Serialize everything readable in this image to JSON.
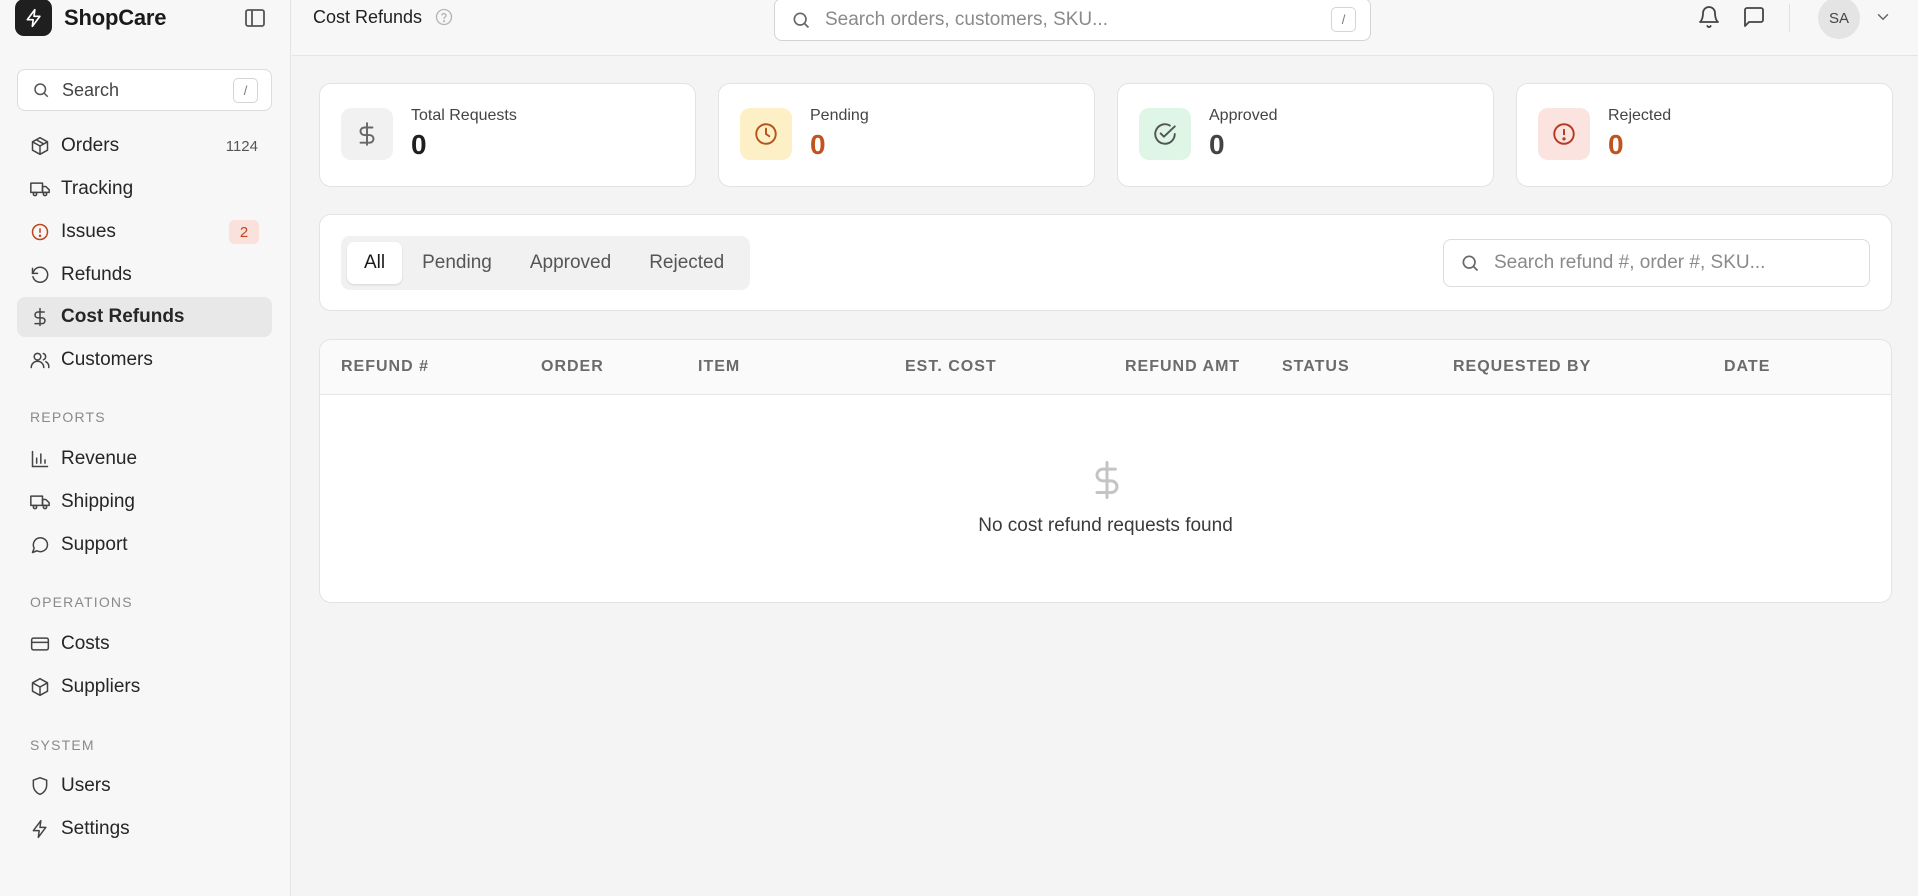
{
  "brand": {
    "name": "ShopCare"
  },
  "sidebar": {
    "search_placeholder": "Search",
    "search_shortcut": "/",
    "items": [
      {
        "label": "Orders",
        "icon": "package-icon",
        "badge": "1124"
      },
      {
        "label": "Tracking",
        "icon": "truck-icon"
      },
      {
        "label": "Issues",
        "icon": "alert-circle-icon",
        "badge": "2"
      },
      {
        "label": "Refunds",
        "icon": "rotate-ccw-icon"
      },
      {
        "label": "Cost Refunds",
        "icon": "dollar-icon",
        "active": true
      },
      {
        "label": "Customers",
        "icon": "users-icon"
      }
    ],
    "sections": [
      {
        "title": "REPORTS",
        "items": [
          {
            "label": "Revenue",
            "icon": "bar-chart-icon"
          },
          {
            "label": "Shipping",
            "icon": "truck-icon"
          },
          {
            "label": "Support",
            "icon": "message-circle-icon"
          }
        ]
      },
      {
        "title": "OPERATIONS",
        "items": [
          {
            "label": "Costs",
            "icon": "credit-card-icon"
          },
          {
            "label": "Suppliers",
            "icon": "box-icon"
          }
        ]
      },
      {
        "title": "SYSTEM",
        "items": [
          {
            "label": "Users",
            "icon": "shield-icon"
          },
          {
            "label": "Settings",
            "icon": "zap-icon"
          }
        ]
      }
    ]
  },
  "header": {
    "title": "Cost Refunds",
    "search_placeholder": "Search orders, customers, SKU...",
    "search_shortcut": "/",
    "avatar_initials": "SA"
  },
  "stats": [
    {
      "label": "Total Requests",
      "value": "0",
      "icon": "dollar-icon",
      "value_color": "#1f1f1f",
      "icon_bg": "#f1f1f1",
      "icon_color": "#666666"
    },
    {
      "label": "Pending",
      "value": "0",
      "icon": "clock-icon",
      "value_color": "#c2531f",
      "icon_bg": "#fdf0c7",
      "icon_color": "#b3551c"
    },
    {
      "label": "Approved",
      "value": "0",
      "icon": "check-circle-icon",
      "value_color": "#444444",
      "icon_bg": "#dff6e7",
      "icon_color": "#555555"
    },
    {
      "label": "Rejected",
      "value": "0",
      "icon": "alert-circle-icon",
      "value_color": "#c2531f",
      "icon_bg": "#fbe3df",
      "icon_color": "#b53a22"
    }
  ],
  "filters": {
    "tabs": [
      "All",
      "Pending",
      "Approved",
      "Rejected"
    ],
    "active_tab": "All",
    "search_placeholder": "Search refund #, order #, SKU..."
  },
  "table": {
    "columns": [
      "REFUND #",
      "ORDER",
      "ITEM",
      "EST. COST",
      "REFUND AMT",
      "STATUS",
      "REQUESTED BY",
      "DATE"
    ],
    "rows": [],
    "empty_message": "No cost refund requests found"
  }
}
